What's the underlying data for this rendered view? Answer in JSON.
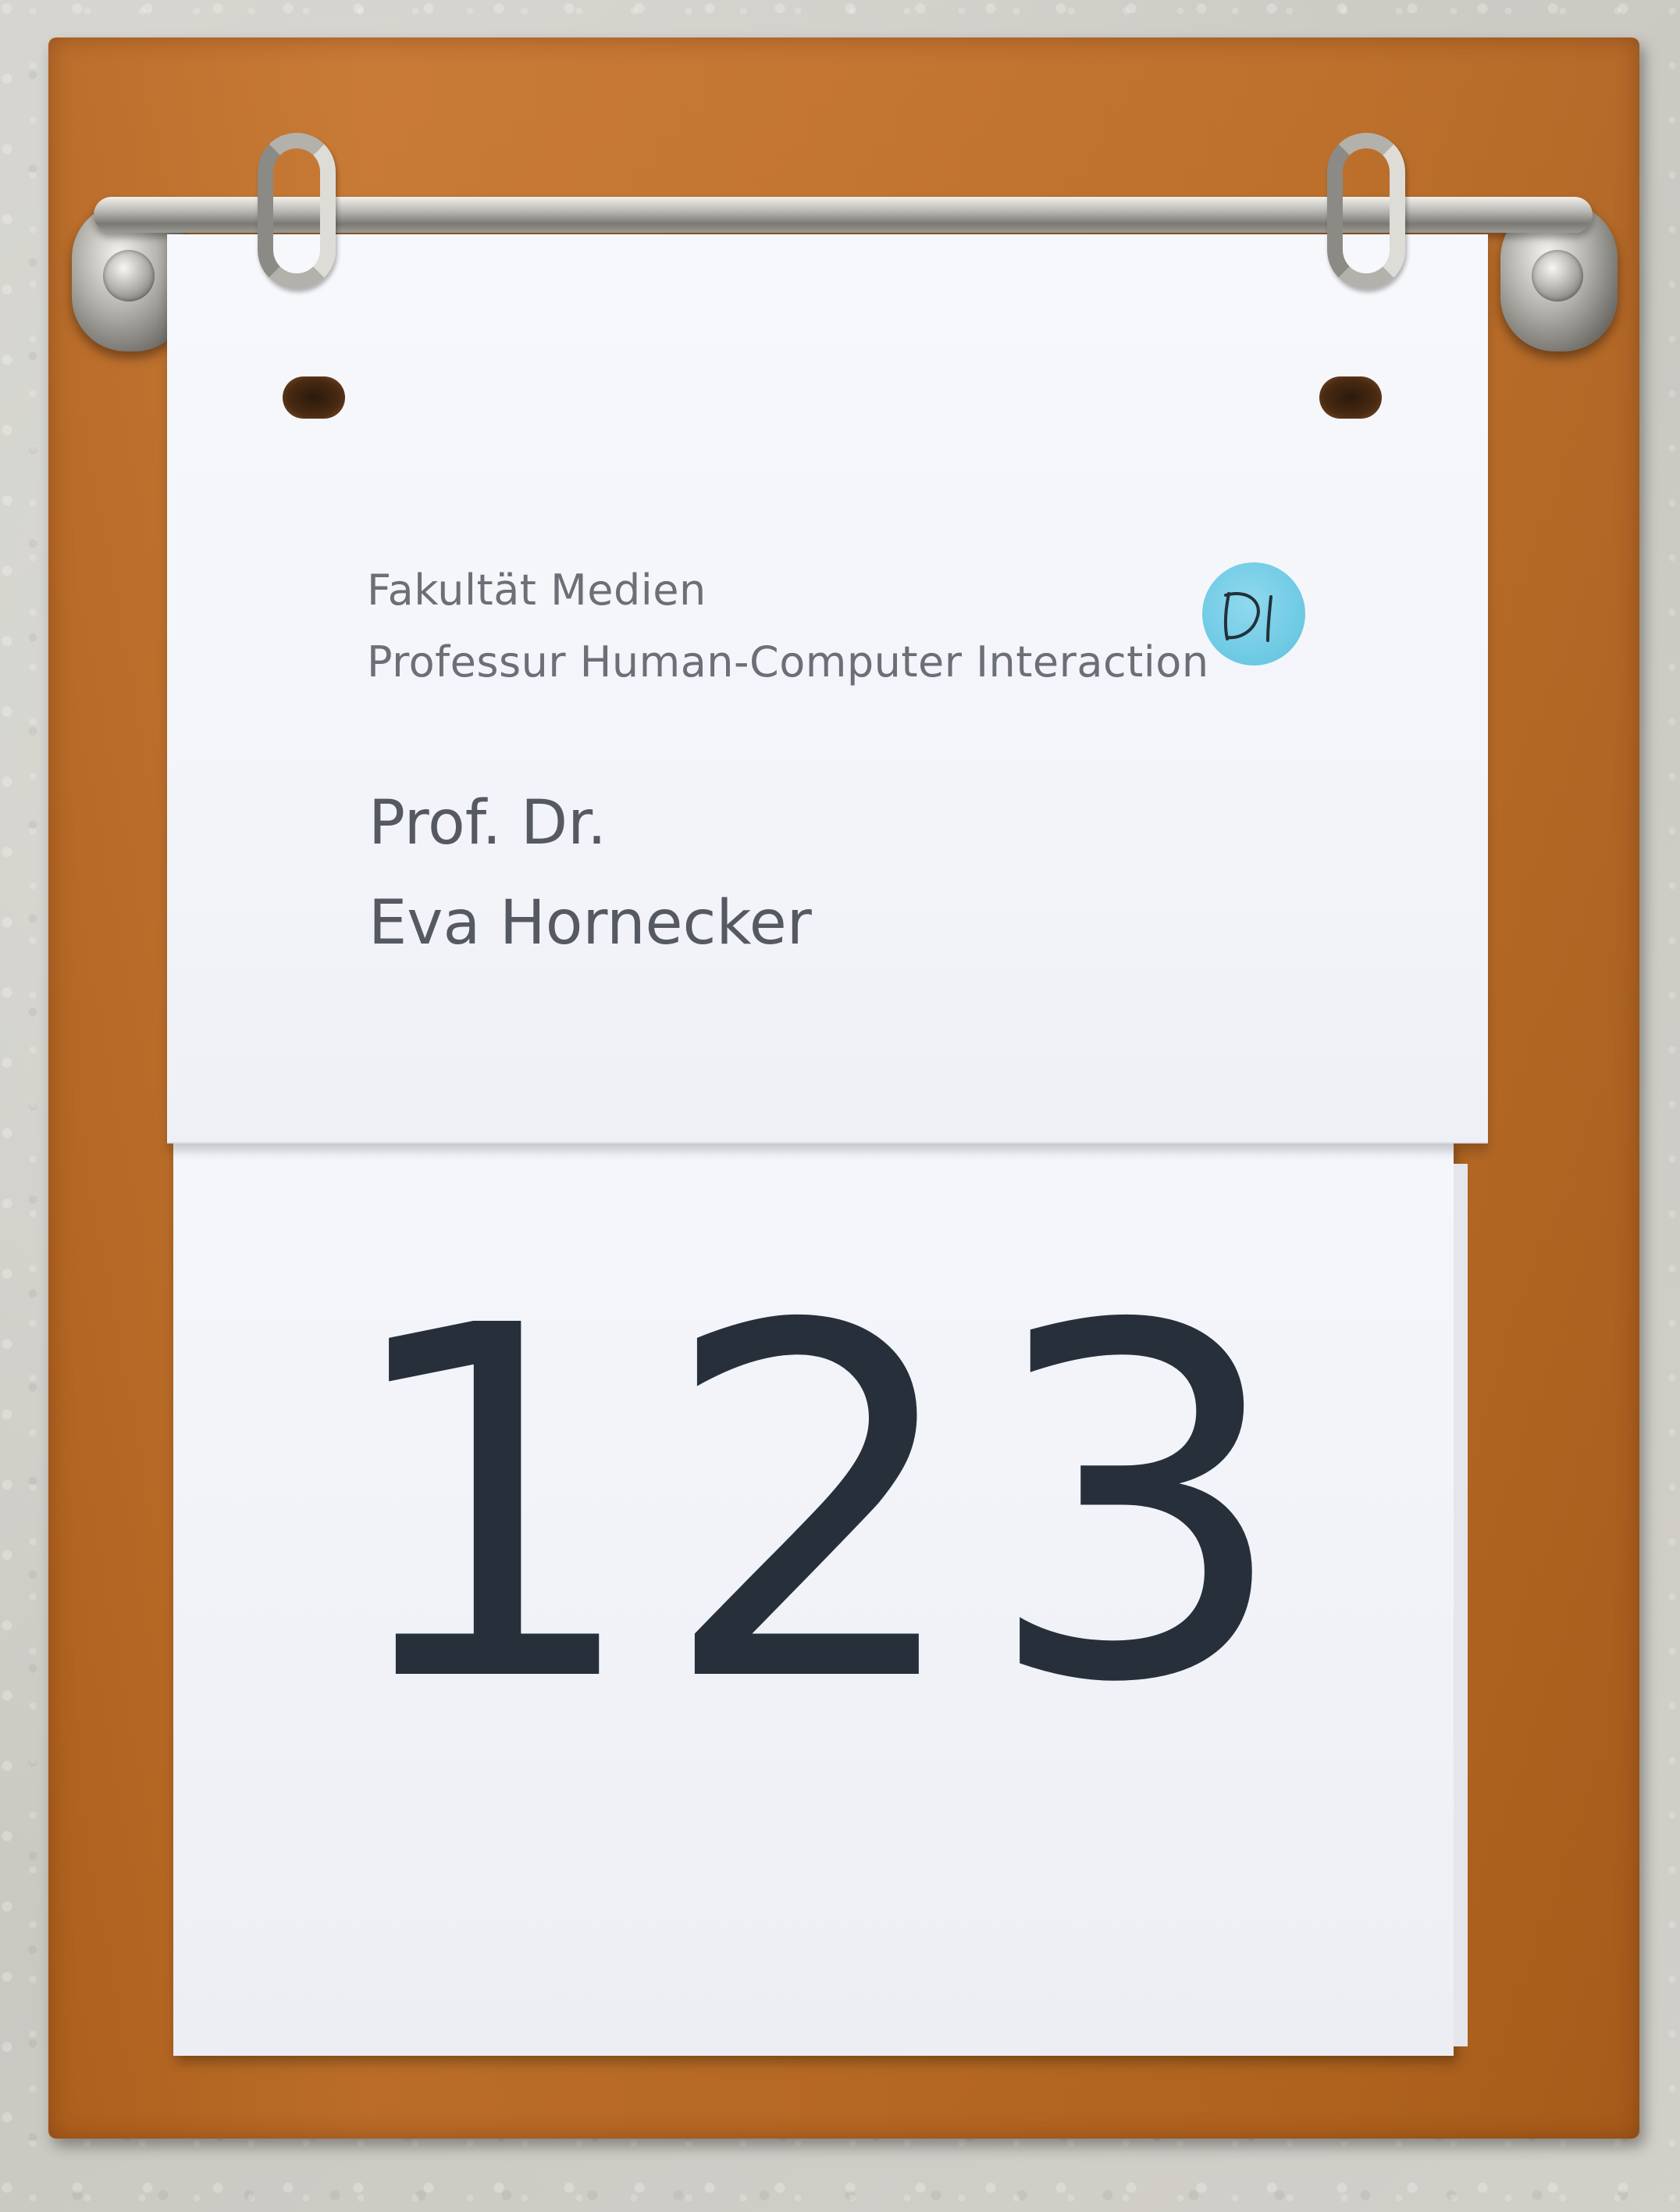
{
  "sign": {
    "faculty_line1": "Fakultät Medien",
    "faculty_line2": "Professur Human-Computer Interaction",
    "title": "Prof. Dr.",
    "name": "Eva Hornecker",
    "room_number": "123",
    "sticker_handwriting": "D1"
  },
  "colors": {
    "board": "#c06e25",
    "paper": "#f3f5fa",
    "text_light": "#6b6f76",
    "text_dark": "#27303a",
    "sticker": "#6cc9e3"
  }
}
